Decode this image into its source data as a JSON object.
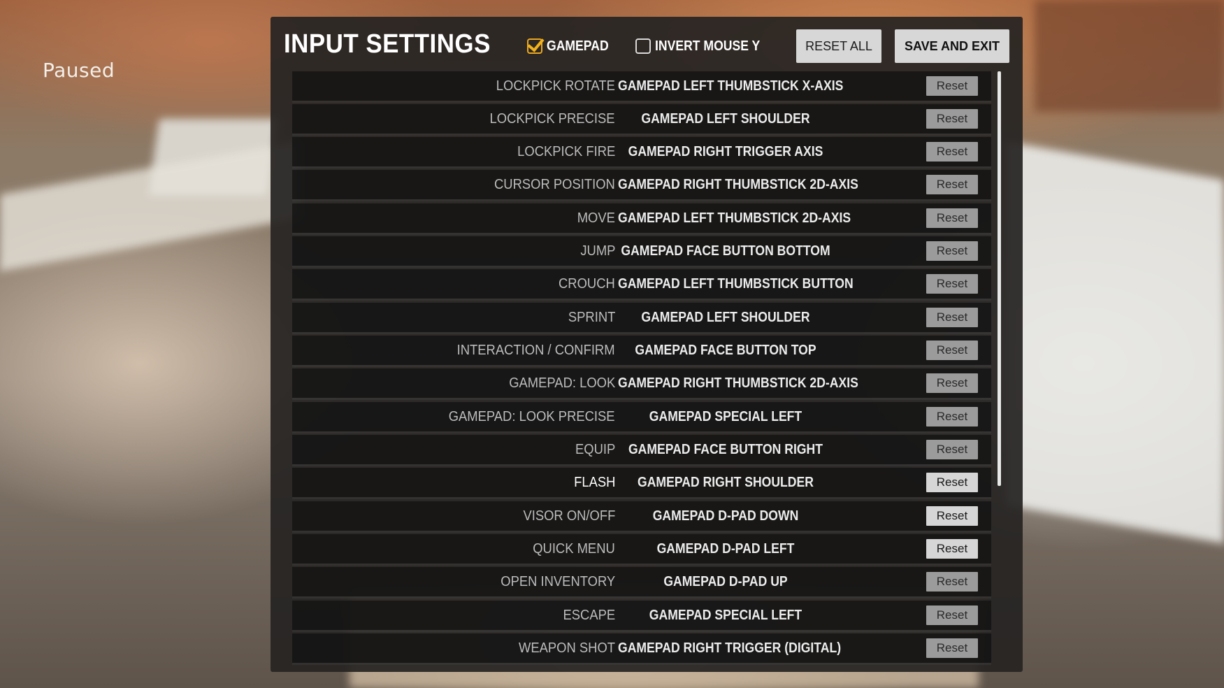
{
  "overlay": {
    "paused_text": "Paused"
  },
  "panel": {
    "title": "INPUT SETTINGS",
    "gamepad_toggle": {
      "label": "GAMEPAD",
      "checked": true
    },
    "invert_mouse_toggle": {
      "label": "INVERT MOUSE Y",
      "checked": false
    },
    "reset_all_label": "RESET ALL",
    "save_exit_label": "SAVE AND EXIT"
  },
  "bindings": [
    {
      "action": "LOCKPICK ROTATE",
      "binding": "GAMEPAD LEFT THUMBSTICK X-AXIS",
      "reset_label": "Reset",
      "highlighted": false
    },
    {
      "action": "LOCKPICK PRECISE",
      "binding": "GAMEPAD LEFT SHOULDER",
      "reset_label": "Reset",
      "highlighted": false
    },
    {
      "action": "LOCKPICK FIRE",
      "binding": "GAMEPAD RIGHT TRIGGER AXIS",
      "reset_label": "Reset",
      "highlighted": false
    },
    {
      "action": "CURSOR POSITION",
      "binding": "GAMEPAD RIGHT THUMBSTICK 2D-AXIS",
      "reset_label": "Reset",
      "highlighted": false
    },
    {
      "action": "MOVE",
      "binding": "GAMEPAD LEFT THUMBSTICK 2D-AXIS",
      "reset_label": "Reset",
      "highlighted": false
    },
    {
      "action": "JUMP",
      "binding": "GAMEPAD FACE BUTTON BOTTOM",
      "reset_label": "Reset",
      "highlighted": false
    },
    {
      "action": "CROUCH",
      "binding": "GAMEPAD LEFT THUMBSTICK BUTTON",
      "reset_label": "Reset",
      "highlighted": false
    },
    {
      "action": "SPRINT",
      "binding": "GAMEPAD LEFT SHOULDER",
      "reset_label": "Reset",
      "highlighted": false
    },
    {
      "action": "INTERACTION / CONFIRM",
      "binding": "GAMEPAD FACE BUTTON TOP",
      "reset_label": "Reset",
      "highlighted": false
    },
    {
      "action": "GAMEPAD: LOOK",
      "binding": "GAMEPAD RIGHT THUMBSTICK 2D-AXIS",
      "reset_label": "Reset",
      "highlighted": false
    },
    {
      "action": "GAMEPAD: LOOK PRECISE",
      "binding": "GAMEPAD SPECIAL LEFT",
      "reset_label": "Reset",
      "highlighted": false
    },
    {
      "action": "EQUIP",
      "binding": "GAMEPAD FACE BUTTON RIGHT",
      "reset_label": "Reset",
      "highlighted": false
    },
    {
      "action": "FLASH",
      "binding": "GAMEPAD RIGHT SHOULDER",
      "reset_label": "Reset",
      "highlighted": true
    },
    {
      "action": "VISOR ON/OFF",
      "binding": "GAMEPAD D-PAD DOWN",
      "reset_label": "Reset",
      "highlighted": true
    },
    {
      "action": "QUICK MENU",
      "binding": "GAMEPAD D-PAD LEFT",
      "reset_label": "Reset",
      "highlighted": true
    },
    {
      "action": "OPEN INVENTORY",
      "binding": "GAMEPAD D-PAD UP",
      "reset_label": "Reset",
      "highlighted": false
    },
    {
      "action": "ESCAPE",
      "binding": "GAMEPAD SPECIAL LEFT",
      "reset_label": "Reset",
      "highlighted": false
    },
    {
      "action": "WEAPON SHOT",
      "binding": "GAMEPAD RIGHT TRIGGER (DIGITAL)",
      "reset_label": "Reset",
      "highlighted": false
    }
  ]
}
